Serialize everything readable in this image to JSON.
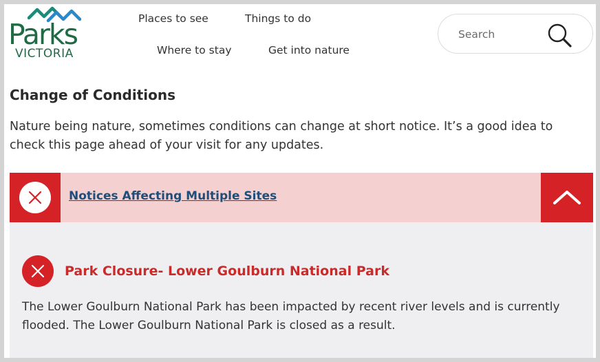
{
  "brand": {
    "name": "Parks",
    "sub": "VICTORIA",
    "colors": {
      "green": "#1e6b46",
      "blue": "#2b88c8",
      "teal": "#1a8a7a"
    }
  },
  "nav": {
    "items": [
      {
        "label": "Places to see"
      },
      {
        "label": "Things to do"
      },
      {
        "label": "Where to stay"
      },
      {
        "label": "Get into nature"
      }
    ]
  },
  "search": {
    "placeholder": "Search",
    "icon": "search-icon"
  },
  "page": {
    "title": "Change of Conditions",
    "intro": "Nature being nature, sometimes conditions can change at short notice. It’s a good idea to check this page ahead of your visit for any updates."
  },
  "accordion": {
    "title": "Notices Affecting Multiple Sites",
    "state": "expanded",
    "icon": "close-icon",
    "toggle_icon": "chevron-up-icon",
    "colors": {
      "header_bg": "#f4d0d0",
      "accent": "#d42227",
      "body_bg": "#efeff2",
      "link": "#1f4e7a"
    },
    "notices": [
      {
        "title": "Park Closure- Lower Goulburn National Park",
        "text": "The Lower Goulburn National Park has been impacted by recent river levels and is currently flooded. The Lower Goulburn National Park is closed as a result."
      }
    ]
  }
}
